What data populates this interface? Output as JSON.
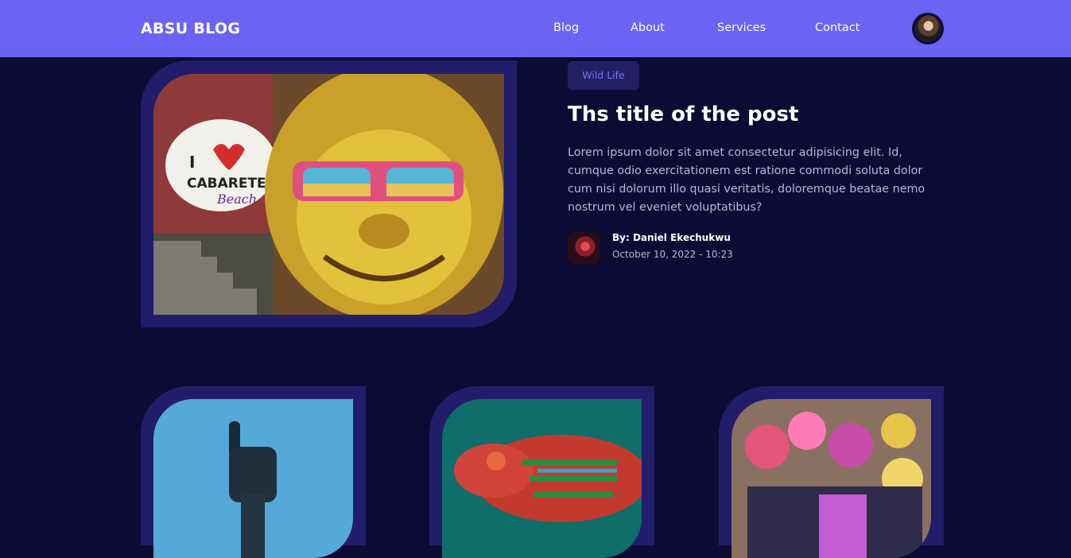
{
  "header": {
    "logo": "ABSU BLOG",
    "nav": [
      "Blog",
      "About",
      "Services",
      "Contact"
    ],
    "avatar_icon": "user-avatar"
  },
  "featured": {
    "tag": "Wild Life",
    "title": "Ths title of the post",
    "excerpt": "Lorem ipsum dolor sit amet consectetur adipisicing elit. Id, cumque odio exercitationem est ratione commodi soluta dolor cum nisi dolorum illo quasi veritatis, doloremque beatae nemo nostrum vel eveniet voluptatibus?",
    "author": "By: Daniel Ekechukwu",
    "date": "October 10, 2022 - 10:23"
  },
  "colors": {
    "background": "#0c0b33",
    "header": "#6c63f5",
    "frame": "#211d6b",
    "tag_text": "#7a73ff",
    "body_text": "#b9b7d4"
  }
}
